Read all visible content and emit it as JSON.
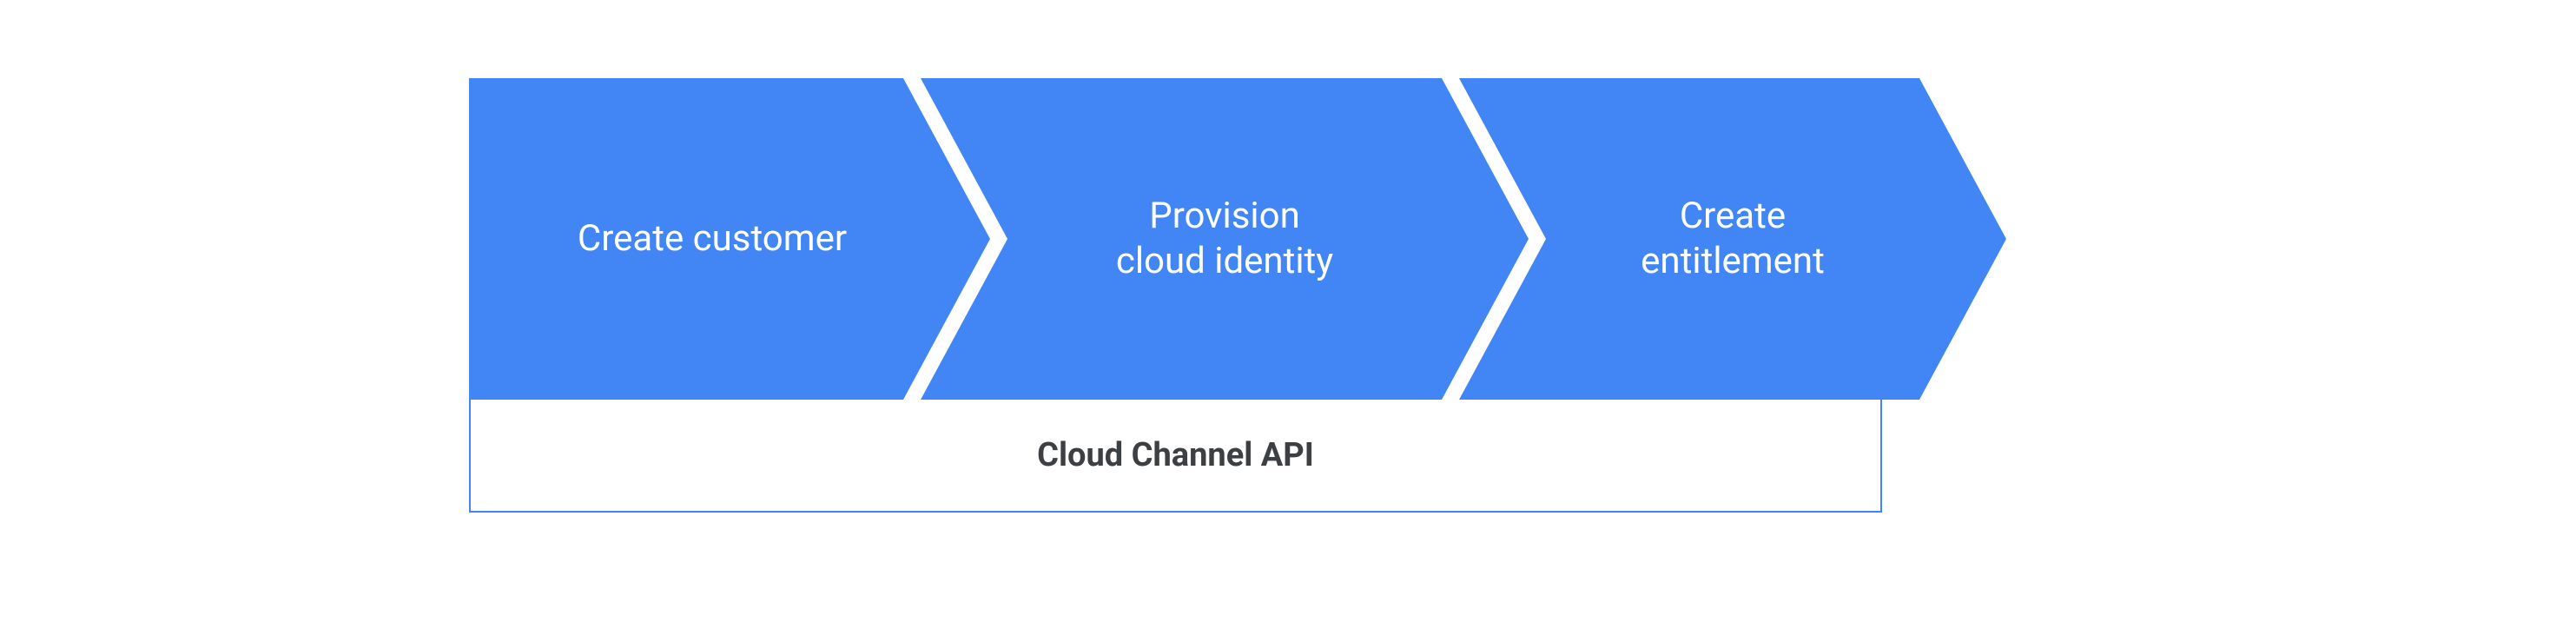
{
  "flow": {
    "steps": [
      {
        "label": "Create customer"
      },
      {
        "label": "Provision\ncloud identity"
      },
      {
        "label": "Create\nentitlement"
      }
    ]
  },
  "footer": {
    "label": "Cloud Channel API"
  },
  "colors": {
    "accent": "#4285f4",
    "footer_text": "#3c4043"
  }
}
